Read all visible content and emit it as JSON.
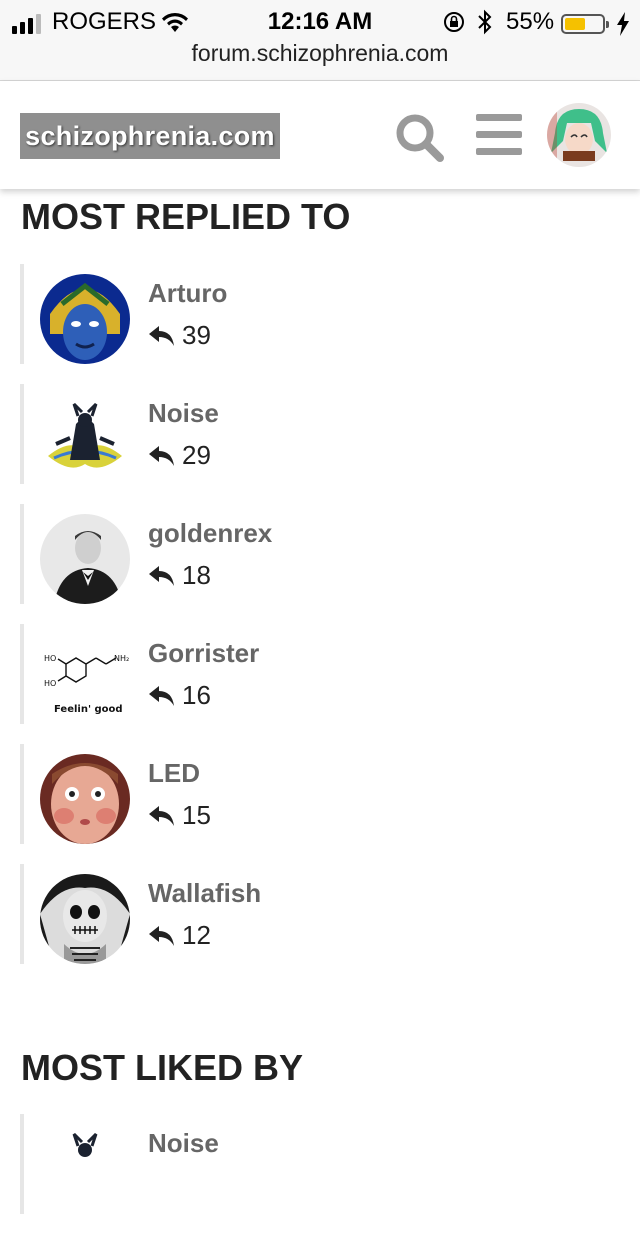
{
  "status_bar": {
    "carrier": "ROGERS",
    "time": "12:16 AM",
    "battery_percent": "55%",
    "battery_level": 0.55,
    "url": "forum.schizophrenia.com"
  },
  "header": {
    "logo_text": "schizophrenia.com",
    "icons": [
      "search-icon",
      "menu-icon",
      "user-avatar"
    ]
  },
  "most_replied": {
    "title": "MOST REPLIED TO",
    "users": [
      {
        "name": "Arturo",
        "count": "39",
        "avatar": "masked-figure-avatar"
      },
      {
        "name": "Noise",
        "count": "29",
        "avatar": "dark-creature-avatar"
      },
      {
        "name": "goldenrex",
        "count": "18",
        "avatar": "man-in-tuxedo-avatar"
      },
      {
        "name": "Gorrister",
        "count": "16",
        "avatar": "dopamine-molecule-avatar",
        "avatar_caption": "Feelin' good"
      },
      {
        "name": "LED",
        "count": "15",
        "avatar": "puffed-cheeks-face-avatar"
      },
      {
        "name": "Wallafish",
        "count": "12",
        "avatar": "skeletal-giant-avatar"
      }
    ]
  },
  "most_liked": {
    "title": "MOST LIKED BY",
    "users": [
      {
        "name": "Noise",
        "avatar": "dark-creature-avatar"
      }
    ]
  },
  "colors": {
    "accent": "#8f8f8f",
    "username": "#666666",
    "battery": "#f5c100"
  }
}
